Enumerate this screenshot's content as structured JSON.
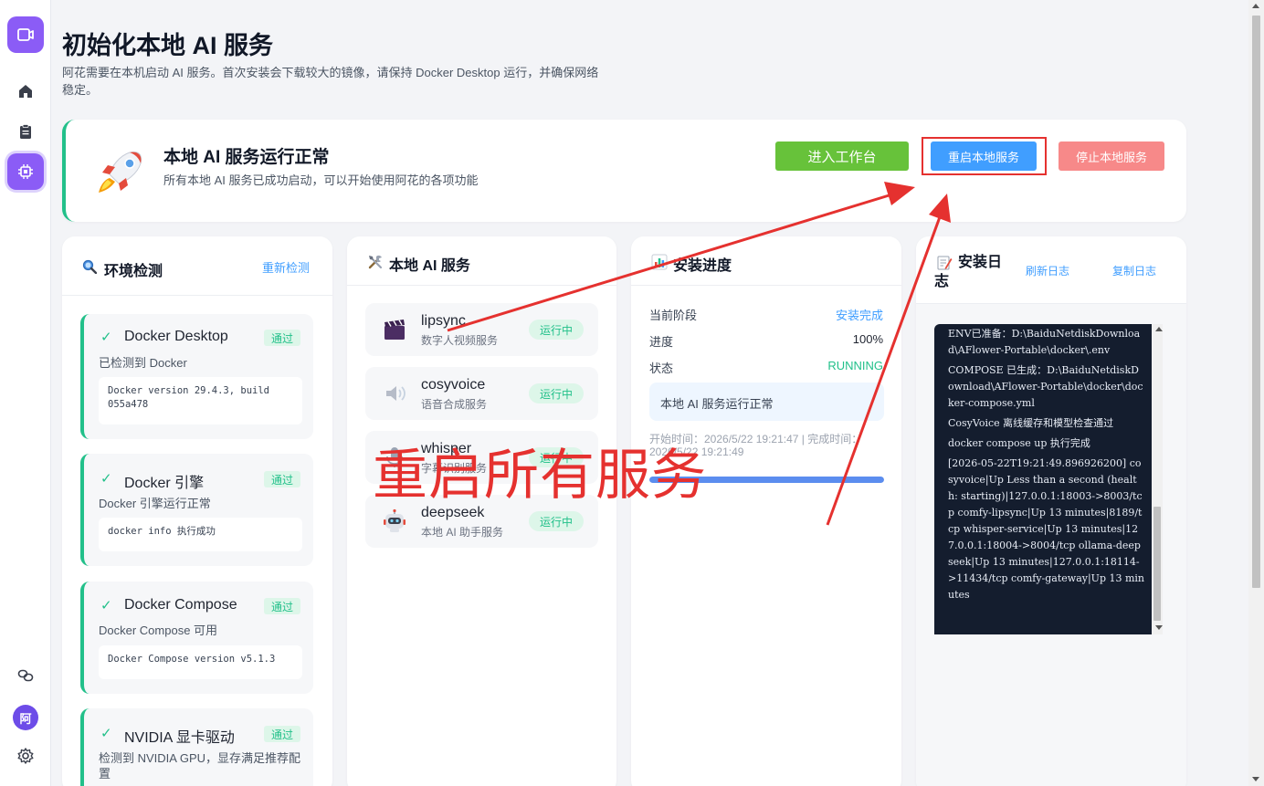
{
  "header": {
    "title": "初始化本地 AI 服务",
    "subtitle": "阿花需要在本机启动 AI 服务。首次安装会下载较大的镜像，请保持 Docker Desktop 运行，并确保网络稳定。"
  },
  "sidebar": {
    "items": [
      {
        "icon": "video-icon"
      },
      {
        "icon": "home-icon"
      },
      {
        "icon": "clipboard-icon"
      },
      {
        "icon": "chip-icon",
        "active": true
      }
    ],
    "bottom": [
      {
        "icon": "link-icon"
      },
      {
        "icon": "settings-icon"
      }
    ],
    "avatar_label": "阿"
  },
  "banner": {
    "title": "本地 AI 服务运行正常",
    "subtitle": "所有本地 AI 服务已成功启动，可以开始使用阿花的各项功能",
    "enter_workspace": "进入工作台",
    "restart_service": "重启本地服务",
    "stop_service": "停止本地服务"
  },
  "env": {
    "title": "环境检测",
    "recheck": "重新检测",
    "cards": [
      {
        "name": "Docker Desktop",
        "badge": "通过",
        "desc": "已检测到 Docker",
        "code": "Docker version 29.4.3, build 055a478"
      },
      {
        "name": "Docker 引擎",
        "badge": "通过",
        "desc": "Docker 引擎运行正常",
        "code": "docker info 执行成功"
      },
      {
        "name": "Docker Compose",
        "badge": "通过",
        "desc": "Docker Compose 可用",
        "code": "Docker Compose version v5.1.3"
      },
      {
        "name": "NVIDIA 显卡驱动",
        "badge": "通过",
        "desc": "检测到 NVIDIA GPU，显存满足推荐配置"
      }
    ]
  },
  "services": {
    "title": "本地 AI 服务",
    "items": [
      {
        "name": "lipsync",
        "desc": "数字人视频服务",
        "status": "运行中",
        "icon": "clapperboard-icon"
      },
      {
        "name": "cosyvoice",
        "desc": "语音合成服务",
        "status": "运行中",
        "icon": "speaker-icon"
      },
      {
        "name": "whisper",
        "desc": "字幕识别服务",
        "status": "运行中",
        "icon": "microphone-icon"
      },
      {
        "name": "deepseek",
        "desc": "本地 AI 助手服务",
        "status": "运行中",
        "icon": "robot-icon"
      }
    ]
  },
  "progress": {
    "title": "安装进度",
    "stage_label": "当前阶段",
    "stage_value": "安装完成",
    "progress_label": "进度",
    "progress_value": "100%",
    "progress_fraction": 1.0,
    "status_label": "状态",
    "status_value": "RUNNING",
    "status_box": "本地 AI 服务运行正常",
    "time_text": "开始时间：2026/5/22 19:21:47 | 完成时间：2026/5/22 19:21:49"
  },
  "log": {
    "title": "安装日志",
    "refresh": "刷新日志",
    "copy": "复制日志",
    "lines": [
      "ENV已准备：D:\\BaiduNetdiskDownload\\AFlower-Portable\\docker\\.env",
      "COMPOSE 已生成：D:\\BaiduNetdiskDownload\\AFlower-Portable\\docker\\docker-compose.yml",
      "CosyVoice 离线缓存和模型检查通过",
      "docker compose up 执行完成",
      "[2026-05-22T19:21:49.896926200] cosyvoice|Up Less than a second (health: starting)|127.0.0.1:18003->8003/tcp comfy-lipsync|Up 13 minutes|8189/tcp whisper-service|Up 13 minutes|127.0.0.1:18004->8004/tcp ollama-deepseek|Up 13 minutes|127.0.0.1:18114->11434/tcp comfy-gateway|Up 13 minutes"
    ]
  },
  "annotation": {
    "text": "重启所有服务",
    "color": "#e5312f"
  },
  "colors": {
    "accent": "#8b5cf6",
    "success": "#22c08a",
    "primary": "#409eff",
    "green_button": "#67c23a",
    "danger_button": "#f78989"
  }
}
